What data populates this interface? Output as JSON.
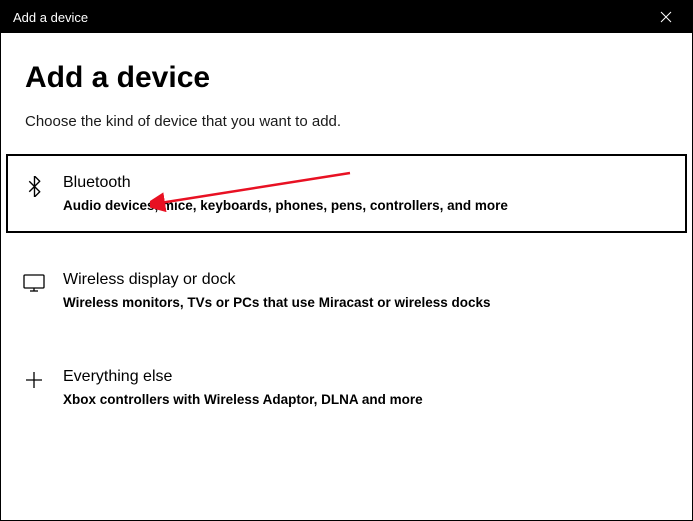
{
  "titlebar": {
    "title": "Add a device"
  },
  "heading": "Add a device",
  "subheading": "Choose the kind of device that you want to add.",
  "options": [
    {
      "title": "Bluetooth",
      "desc": "Audio devices, mice, keyboards, phones, pens, controllers, and more"
    },
    {
      "title": "Wireless display or dock",
      "desc": "Wireless monitors, TVs or PCs that use Miracast or wireless docks"
    },
    {
      "title": "Everything else",
      "desc": "Xbox controllers with Wireless Adaptor, DLNA and more"
    }
  ]
}
